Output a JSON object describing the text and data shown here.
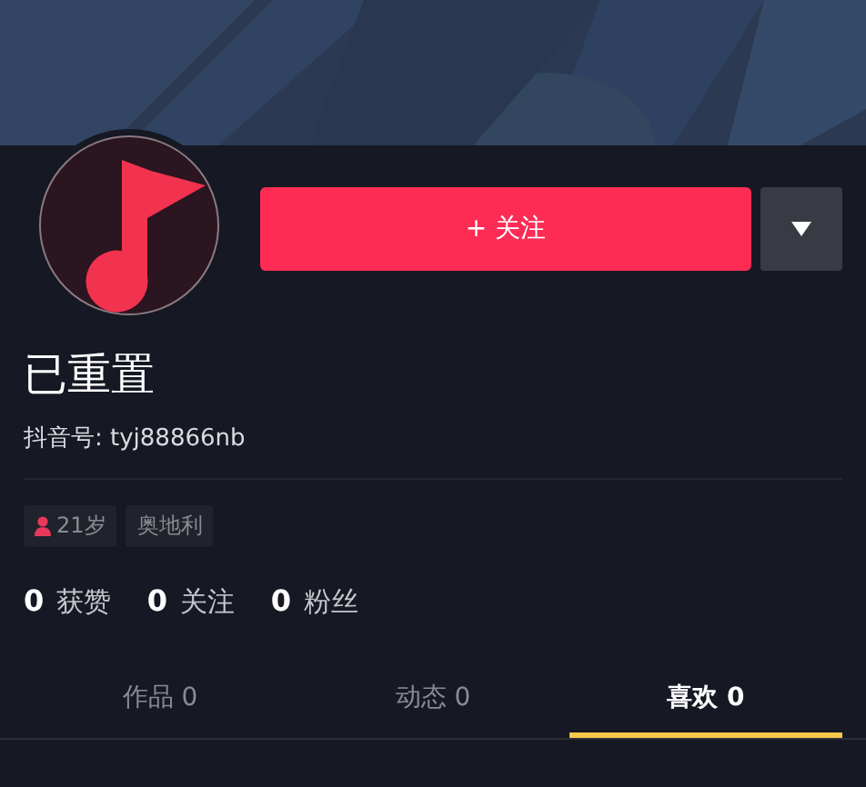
{
  "follow_button": {
    "label": "+ 关注"
  },
  "profile": {
    "name": "已重置",
    "id_label": "抖音号: tyj88866nb"
  },
  "tags": [
    {
      "kind": "gender",
      "label": "21岁"
    },
    {
      "kind": "location",
      "label": "奥地利"
    }
  ],
  "stats": [
    "**0** 获赞",
    "**0** 关注",
    "**0** 粉丝"
  ],
  "tabs": [
    {
      "label": "作品 0",
      "selected": false
    },
    {
      "label": "动态 0",
      "selected": false
    },
    {
      "label": "喜欢 0",
      "selected": true
    }
  ]
}
